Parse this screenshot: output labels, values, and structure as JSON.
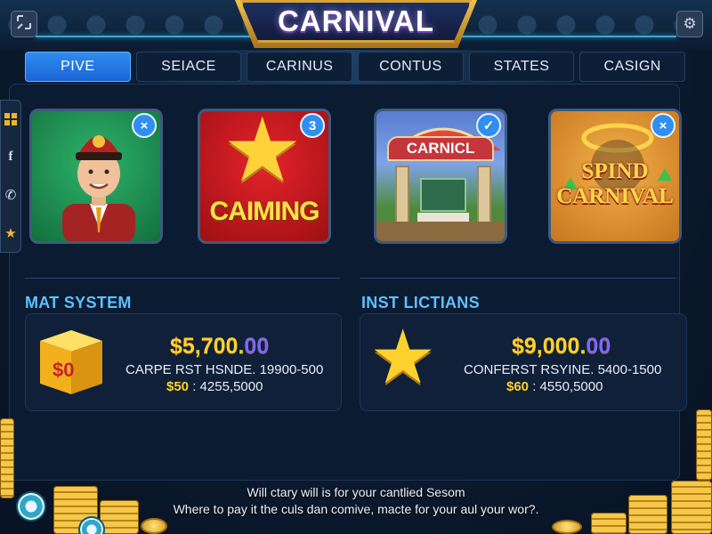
{
  "window": {
    "title": "CARNIVAL",
    "left_icon": "fullscreen-icon",
    "right_icon": "gear-icon"
  },
  "tabs": [
    {
      "label": "PIVE",
      "active": true
    },
    {
      "label": "SEIACE",
      "active": false
    },
    {
      "label": "CARINUS",
      "active": false
    },
    {
      "label": "CONTUS",
      "active": false
    },
    {
      "label": "STATES",
      "active": false
    },
    {
      "label": "CASIGN",
      "active": false
    }
  ],
  "side_rail": {
    "icons": [
      "windows-icon",
      "facebook-icon",
      "phone-icon",
      "star-icon"
    ]
  },
  "cards": [
    {
      "art": "conductor",
      "badge": "×",
      "badge_icon": "close-icon"
    },
    {
      "art": "star",
      "title": "CAIMING",
      "badge": "3",
      "badge_icon": "count-badge"
    },
    {
      "art": "carnival-gate",
      "title": "CARNICL",
      "badge": "✓",
      "badge_icon": "check-icon"
    },
    {
      "art": "spin-wheel",
      "title_line1": "SPIND",
      "title_line2": "CARNIVAL",
      "badge": "×",
      "badge_icon": "close-icon"
    }
  ],
  "sections": {
    "left": {
      "heading": "MAT SYSTEM",
      "icon": "coin-box-icon",
      "icon_text": "$0",
      "amount_main": "$5,700.",
      "amount_cents": "00",
      "line1": "CARPE RST HSNDE. 19900-500",
      "line2_gold": "$50",
      "line2_rest": ": 4255,5000"
    },
    "right": {
      "heading": "INST LICTIANS",
      "icon": "star-icon",
      "amount_main": "$9,000.",
      "amount_cents": "00",
      "line1": "CONFERST RSYINE. 5400-1500",
      "line2_gold": "$60",
      "line2_rest": ": 4550,5000"
    }
  },
  "footer": {
    "line1": "Will ctary will is for your cantlied Sesom",
    "line2": "Where to pay it the culs dan comive, macte for your aul your wor?."
  },
  "colors": {
    "accent_blue": "#2f8cf0",
    "heading_blue": "#5fc0ff",
    "gold": "#ffd12e",
    "title_frame": "#d7a336"
  }
}
